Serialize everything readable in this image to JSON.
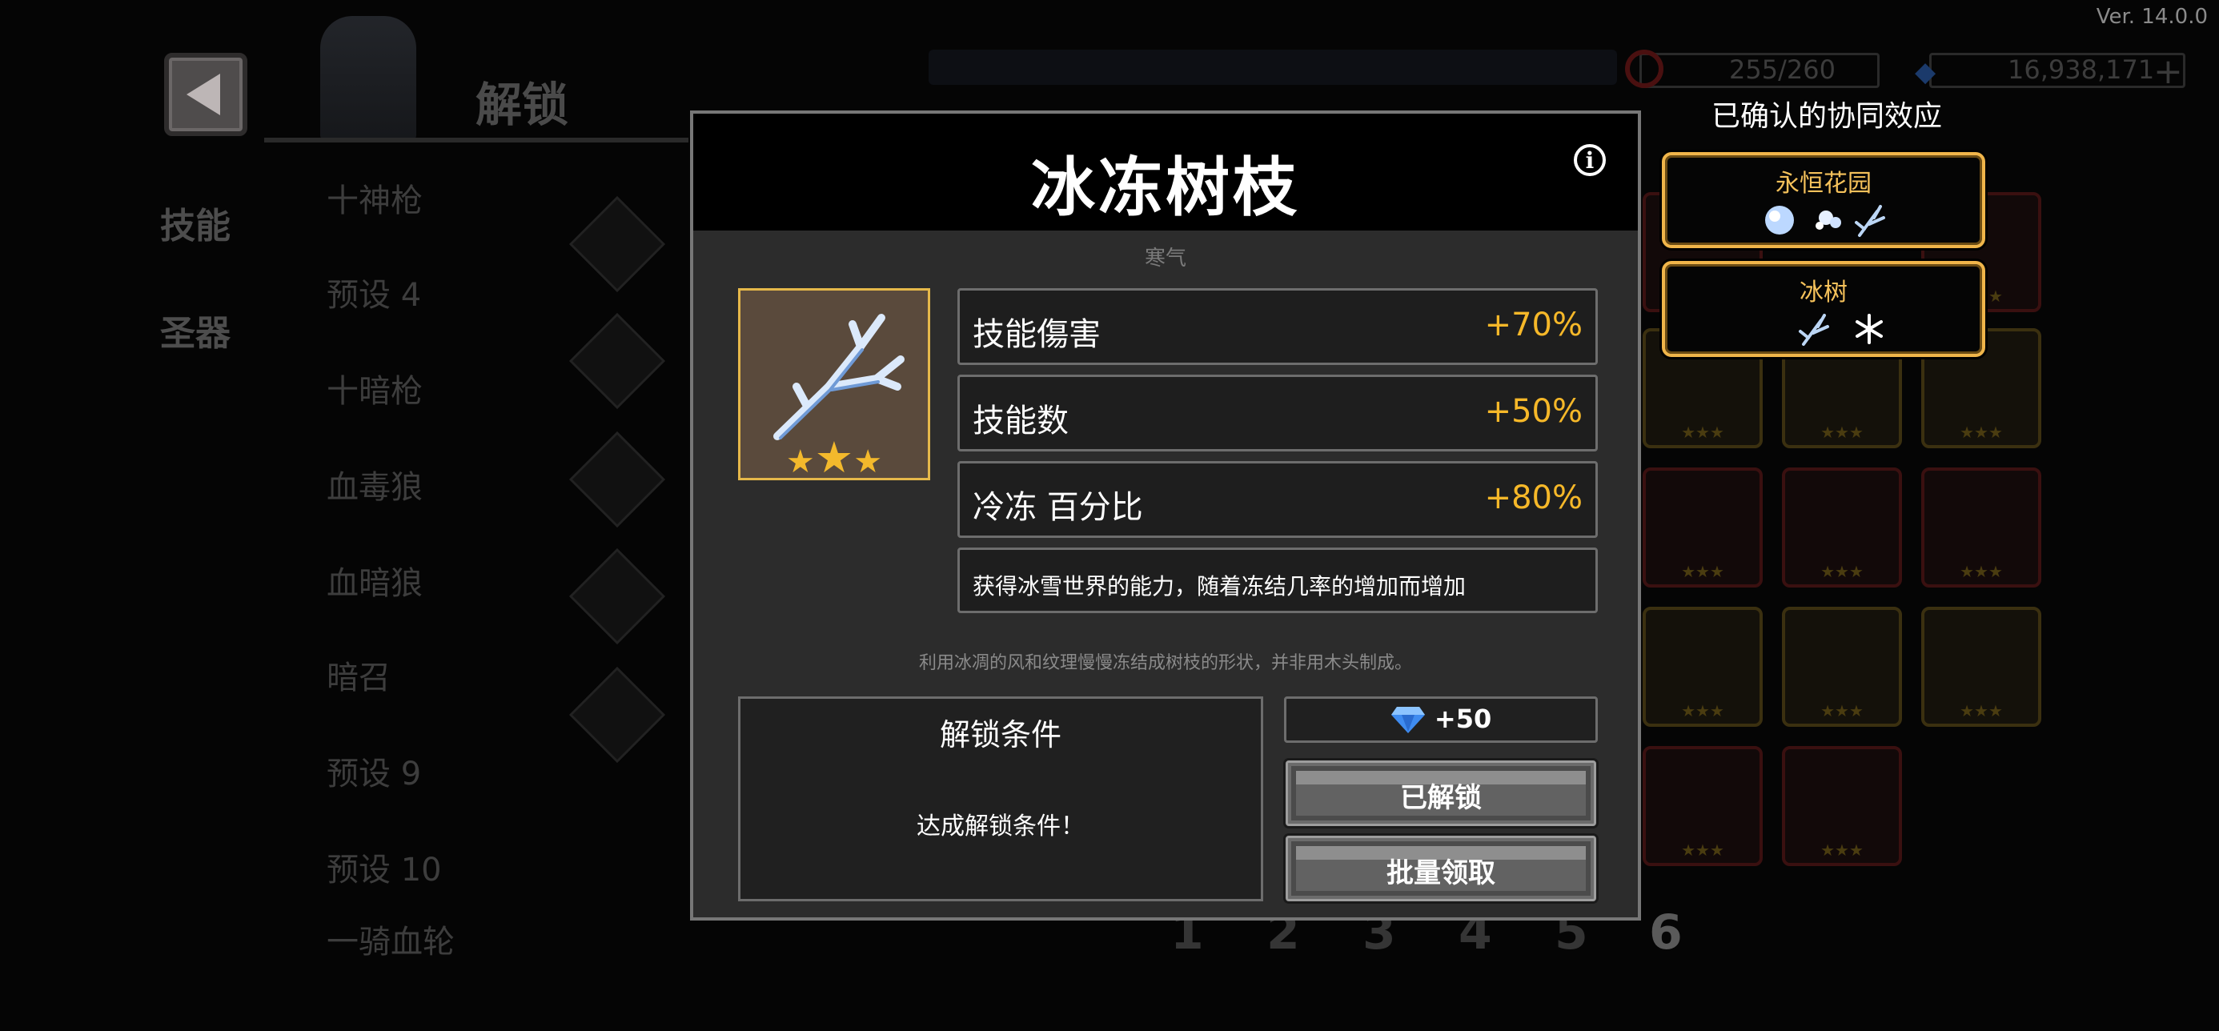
{
  "version": "Ver. 14.0.0",
  "header": {
    "title": "解锁",
    "energy": "255/260",
    "gems": "16,938,171"
  },
  "side_tabs": [
    "技能",
    "圣器"
  ],
  "presets": [
    "十神枪",
    "预设 4",
    "十暗枪",
    "血毒狼",
    "血暗狼",
    "暗召",
    "预设 9",
    "预设 10",
    "一骑血轮"
  ],
  "pages": [
    "1",
    "2",
    "3",
    "4",
    "5",
    "6"
  ],
  "synergy": {
    "heading": "已确认的协同效应",
    "cards": [
      {
        "name": "永恒花园",
        "icons": [
          "ice-orb",
          "snow-cloud",
          "frozen-branch"
        ]
      },
      {
        "name": "冰树",
        "icons": [
          "frozen-branch",
          "snowflake"
        ]
      }
    ]
  },
  "modal": {
    "title": "冰冻树枝",
    "category": "寒气",
    "item_icon": "frozen-branch",
    "stars": 3,
    "stats": [
      {
        "name": "技能傷害",
        "value": "+70%"
      },
      {
        "name": "技能数",
        "value": "+50%"
      },
      {
        "name": "冷冻 百分比",
        "value": "+80%"
      }
    ],
    "description": "获得冰雪世界的能力，随着冻结几率的增加而增加",
    "flavor": "利用冰凋的风和纹理慢慢冻结成树枝的形状，并非用木头制成。",
    "unlock": {
      "title": "解锁条件",
      "message": "达成解锁条件！"
    },
    "reward": "+50",
    "buttons": {
      "unlocked": "已解锁",
      "bulk_claim": "批量领取"
    }
  },
  "colors": {
    "stat_value": "#f6b829",
    "synergy_border": "#f0b54a",
    "item_frame": "#e6b84a"
  }
}
